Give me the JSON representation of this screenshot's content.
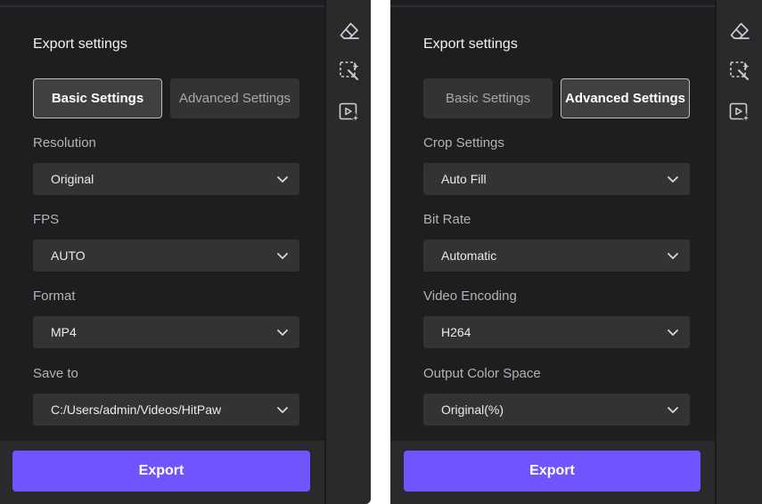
{
  "left_panel": {
    "title": "Export settings",
    "tabs": {
      "basic": "Basic Settings",
      "advanced": "Advanced Settings",
      "active": "basic"
    },
    "fields": [
      {
        "label": "Resolution",
        "value": "Original"
      },
      {
        "label": "FPS",
        "value": "AUTO"
      },
      {
        "label": "Format",
        "value": "MP4"
      },
      {
        "label": "Save to",
        "value": "C:/Users/admin/Videos/HitPaw"
      }
    ],
    "export_label": "Export"
  },
  "right_panel": {
    "title": "Export settings",
    "tabs": {
      "basic": "Basic Settings",
      "advanced": "Advanced Settings",
      "active": "advanced"
    },
    "fields": [
      {
        "label": "Crop Settings",
        "value": "Auto Fill"
      },
      {
        "label": "Bit Rate",
        "value": "Automatic"
      },
      {
        "label": "Video Encoding",
        "value": "H264"
      },
      {
        "label": "Output Color Space",
        "value": "Original(%)"
      }
    ],
    "export_label": "Export"
  },
  "tool_rail": {
    "icons": [
      "eraser-icon",
      "magic-select-icon",
      "ai-video-icon"
    ]
  },
  "colors": {
    "accent": "#6f55ff",
    "panel_bg": "#1e1e20",
    "control_bg": "#333336"
  }
}
